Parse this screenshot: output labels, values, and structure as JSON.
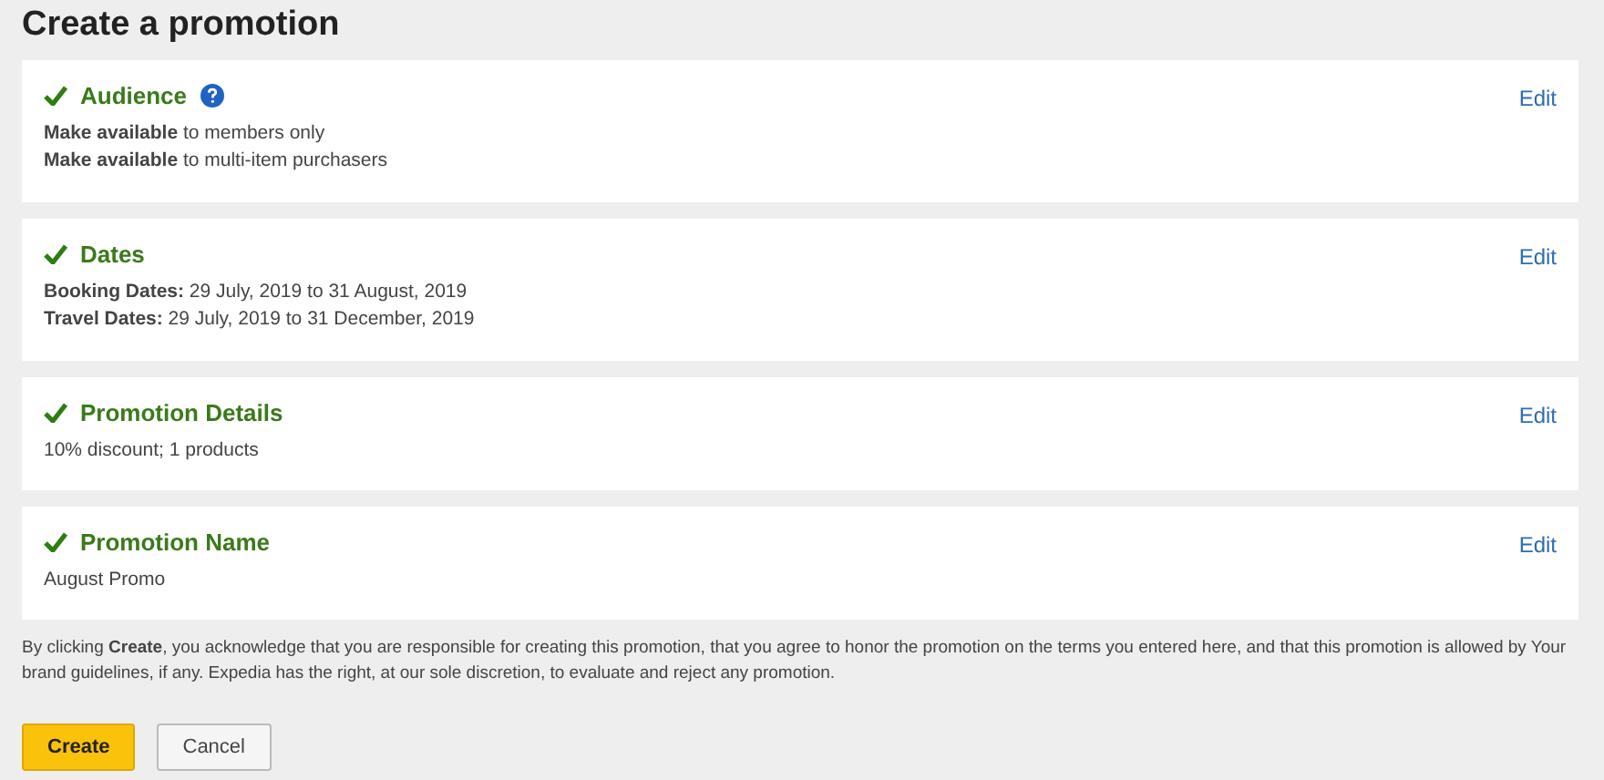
{
  "title": "Create a promotion",
  "sections": [
    {
      "title": "Audience",
      "complete": true,
      "help": true,
      "edit": "Edit",
      "lines": [
        "**Make available** to members only",
        "**Make available** to multi-item purchasers"
      ]
    },
    {
      "title": "Dates",
      "complete": true,
      "help": false,
      "edit": "Edit",
      "lines": [
        "**Booking Dates:** 29 July, 2019 to 31 August, 2019",
        "**Travel Dates:** 29 July, 2019 to 31 December, 2019"
      ]
    },
    {
      "title": "Promotion Details",
      "complete": true,
      "help": false,
      "edit": "Edit",
      "lines": [
        "10% discount; 1 products"
      ]
    },
    {
      "title": "Promotion Name",
      "complete": true,
      "help": false,
      "edit": "Edit",
      "lines": [
        "August Promo"
      ]
    }
  ],
  "terms": "By clicking **Create**, you acknowledge that you are responsible for creating this promotion, that you agree to honor the promotion on the terms you entered here, and that this promotion is allowed by Your brand guidelines, if any. Expedia has the right, at our sole discretion, to evaluate and reject any promotion.",
  "buttons": [
    {
      "label": "Create",
      "kind": "primary"
    },
    {
      "label": "Cancel",
      "kind": "secondary"
    }
  ]
}
